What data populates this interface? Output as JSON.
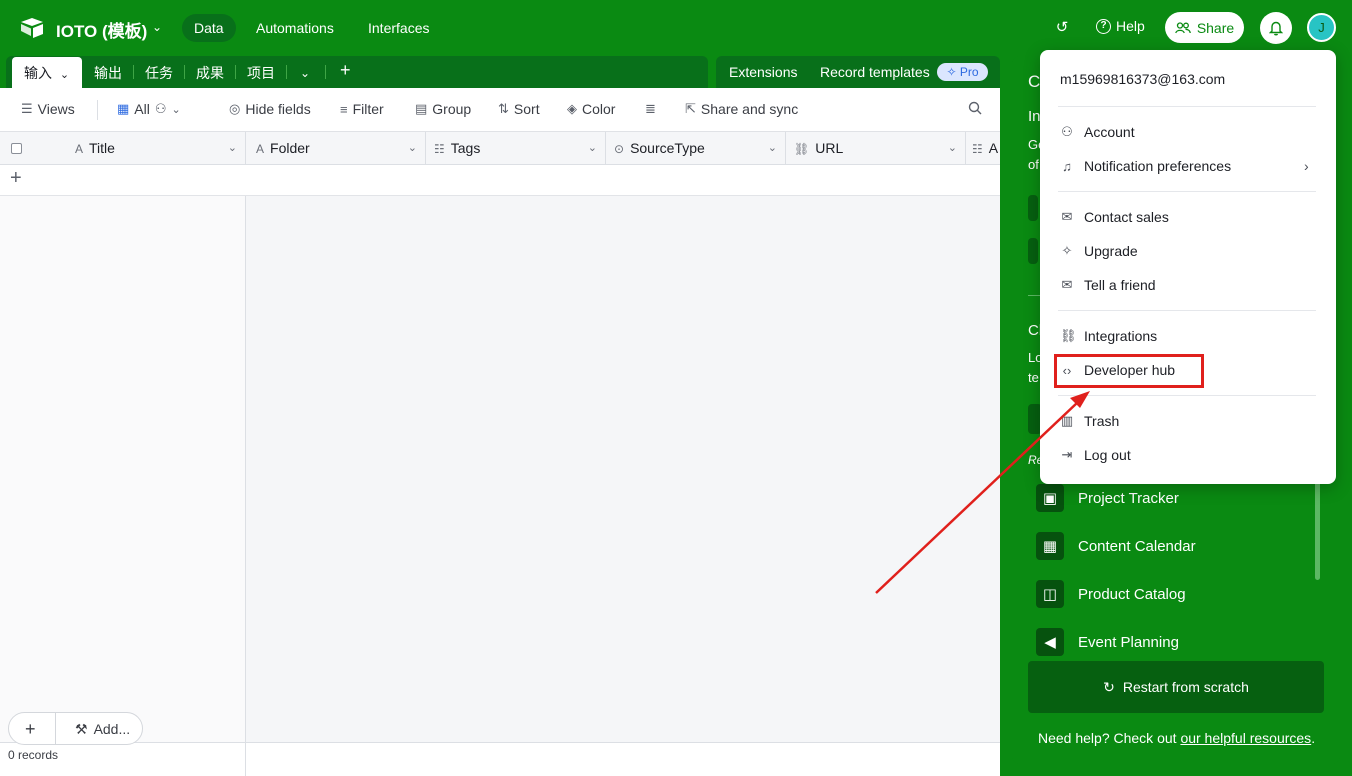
{
  "topbar": {
    "app_title": "IOTO (模板)",
    "nav": [
      "Data",
      "Automations",
      "Interfaces"
    ],
    "help_label": "Help",
    "share_label": "Share",
    "avatar_letter": "J"
  },
  "table_tabs": [
    "输入",
    "输出",
    "任务",
    "成果",
    "项目"
  ],
  "extensions": {
    "extensions_label": "Extensions",
    "record_templates_label": "Record templates",
    "pro_badge": "Pro"
  },
  "toolbar": {
    "views": "Views",
    "all": "All",
    "hide_fields": "Hide fields",
    "filter": "Filter",
    "group": "Group",
    "sort": "Sort",
    "color": "Color",
    "share_sync": "Share and sync"
  },
  "columns": [
    "Title",
    "Folder",
    "Tags",
    "SourceType",
    "URL",
    "A"
  ],
  "footer": {
    "records": "0 records",
    "add_label": "Add..."
  },
  "side_panel": {
    "frag_c": "C",
    "frag_in": "In",
    "frag_ge": "Ge",
    "frag_of": "of",
    "frag_cl": "Cl",
    "frag_lo": "Lo",
    "frag_te": "te",
    "frag_re": "Re",
    "templates": [
      "Project Tracker",
      "Content Calendar",
      "Product Catalog",
      "Event Planning"
    ],
    "restart": "Restart from scratch",
    "needhelp_prefix": "Need help? Check out ",
    "needhelp_link": "our helpful resources",
    "needhelp_suffix": "."
  },
  "menu": {
    "email": "m15969816373@163.com",
    "account": "Account",
    "notification_prefs": "Notification preferences",
    "contact_sales": "Contact sales",
    "upgrade": "Upgrade",
    "tell_friend": "Tell a friend",
    "integrations": "Integrations",
    "developer_hub": "Developer hub",
    "trash": "Trash",
    "log_out": "Log out"
  },
  "colors": {
    "brand_green": "#0a8a12",
    "highlight_red": "#e0201c",
    "pro_badge_bg": "#dbe6fe"
  }
}
